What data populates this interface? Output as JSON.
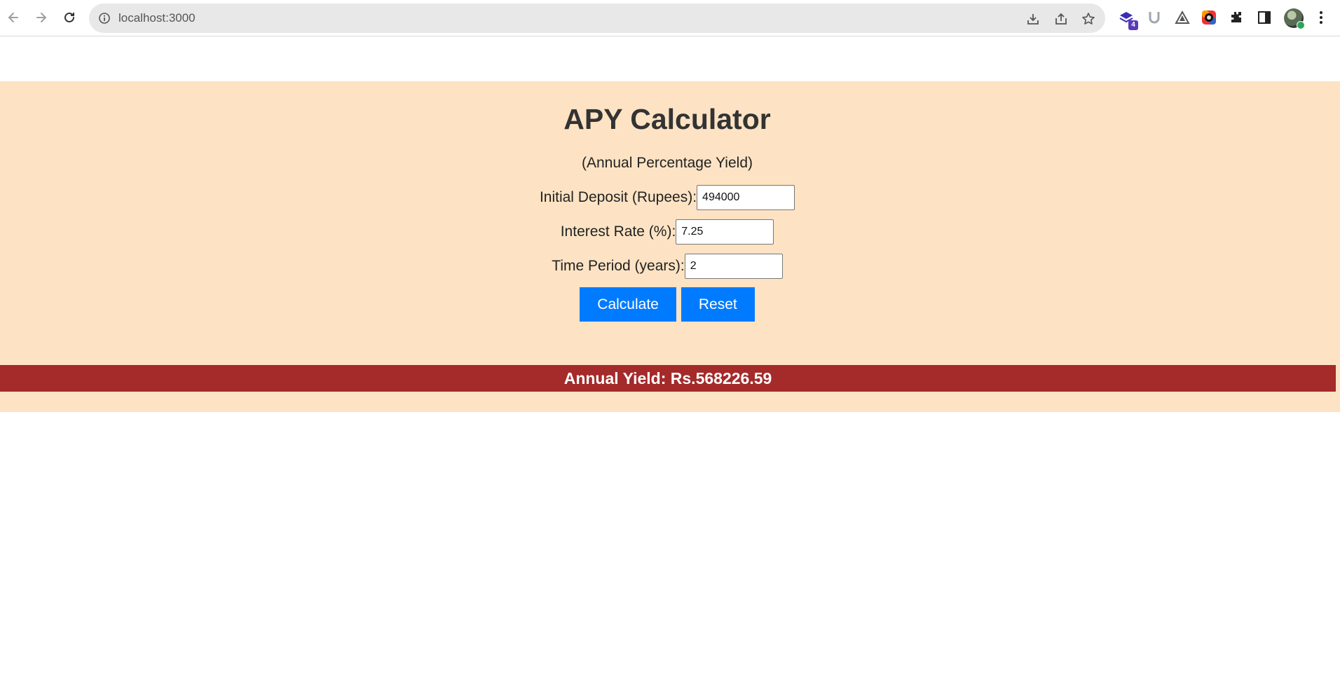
{
  "browser": {
    "url": "localhost:3000",
    "extension_badge": "4"
  },
  "app": {
    "title": "APY Calculator",
    "subtitle": "(Annual Percentage Yield)",
    "fields": [
      {
        "label": "Initial Deposit (Rupees):",
        "value": "494000"
      },
      {
        "label": "Interest Rate (%):",
        "value": "7.25"
      },
      {
        "label": "Time Period (years):",
        "value": "2"
      }
    ],
    "calculate_label": "Calculate",
    "reset_label": "Reset",
    "result_text": "Annual Yield: Rs.568226.59"
  },
  "colors": {
    "background": "#fde3c4",
    "button": "#007bff",
    "result_bar": "#a52a2a"
  }
}
